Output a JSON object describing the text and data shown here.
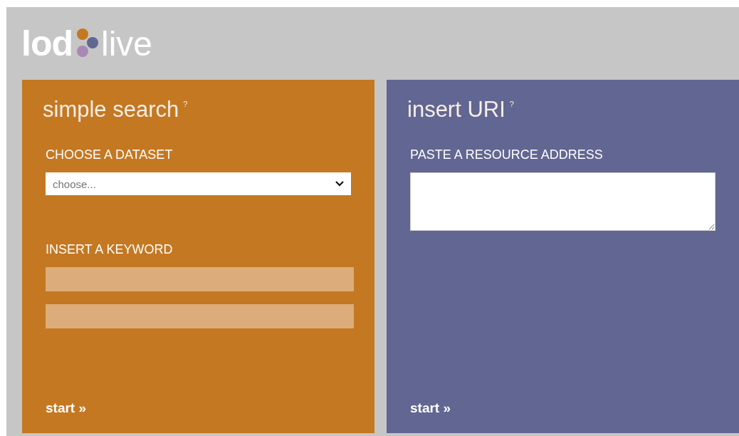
{
  "logo": {
    "bold_part": "lod",
    "light_part": "live"
  },
  "panels": [
    {
      "color": "#c47822",
      "title": "simple search",
      "help": "?",
      "fields": [
        {
          "kind": "label",
          "text": "CHOOSE A DATASET"
        },
        {
          "kind": "select",
          "value": "choose..."
        },
        {
          "kind": "label",
          "text": "INSERT A KEYWORD"
        },
        {
          "kind": "input"
        },
        {
          "kind": "input"
        }
      ],
      "button": {
        "label": "start",
        "arrow": "»"
      }
    },
    {
      "color": "#626692",
      "title": "insert URI",
      "help": "?",
      "fields": [
        {
          "kind": "label",
          "text": "PASTE A RESOURCE ADDRESS"
        },
        {
          "kind": "textarea"
        }
      ],
      "button": {
        "label": "start",
        "arrow": "»"
      }
    }
  ]
}
